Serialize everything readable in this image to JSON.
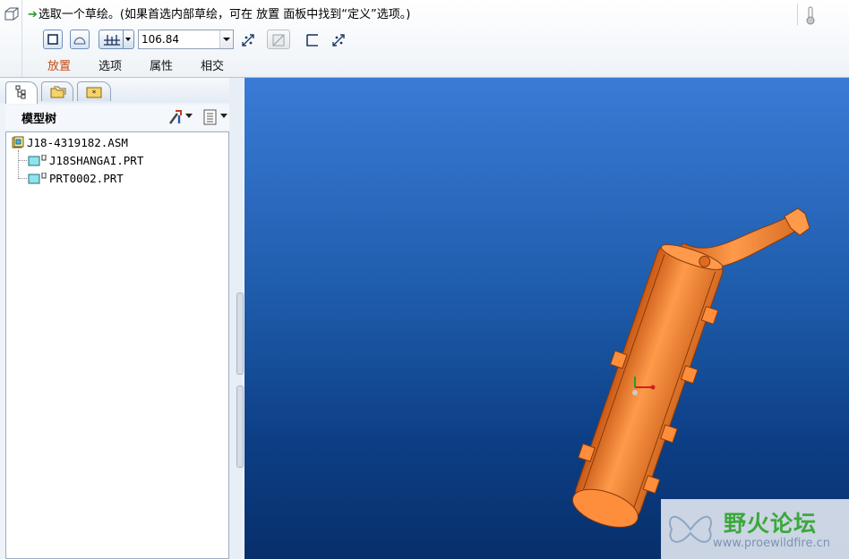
{
  "dashboard": {
    "prompt": "选取一个草绘。(如果首选内部草绘，可在 放置 面板中找到“定义”选项。)",
    "depth_value": "106.84",
    "tabs": [
      {
        "label": "放置",
        "active": true
      },
      {
        "label": "选项",
        "active": false
      },
      {
        "label": "属性",
        "active": false
      },
      {
        "label": "相交",
        "active": false
      }
    ],
    "accent_color": "#c24a10"
  },
  "navigator": {
    "tree_title": "模型树",
    "tree_items": [
      {
        "label": "J18-4319182.ASM",
        "type": "assembly"
      },
      {
        "label": "J18SHANGAI.PRT",
        "type": "part"
      },
      {
        "label": "PRT0002.PRT",
        "type": "part"
      }
    ]
  },
  "viewport": {
    "model_color": "#f07a2a"
  },
  "watermark": {
    "title": "野火论坛",
    "url": "www.proewildfire.cn"
  }
}
